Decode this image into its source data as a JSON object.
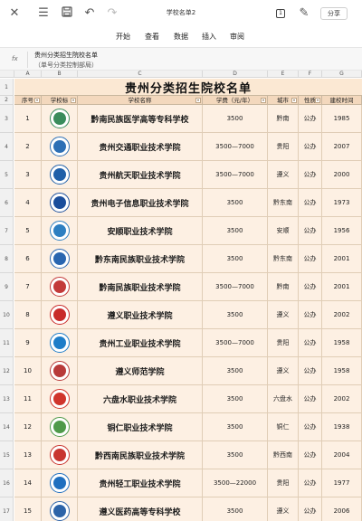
{
  "doc_title": "学校名单2",
  "toolbar": {
    "share_label": "分享",
    "badge_label": "1"
  },
  "menu": [
    "开始",
    "查看",
    "数据",
    "插入",
    "审阅"
  ],
  "formula": {
    "fx_label": "fx",
    "line1": "贵州分类招生院校名单",
    "line2": "（单号分类控制部局）"
  },
  "columns": [
    "A",
    "B",
    "C",
    "D",
    "E",
    "F",
    "G"
  ],
  "sheet": {
    "title": "贵州分类招生院校名单",
    "headers": [
      "序号",
      "学校标",
      "学校名称",
      "学费（元/年）",
      "城市",
      "性质",
      "建校时间"
    ]
  },
  "rows": [
    {
      "row": "3",
      "no": "1",
      "name": "黔南民族医学高等专科学校",
      "fee": "3500",
      "city": "黔南",
      "type": "公办",
      "year": "1985",
      "logo_color": "#3a8c5c"
    },
    {
      "row": "4",
      "no": "2",
      "name": "贵州交通职业技术学院",
      "fee": "3500—7000",
      "city": "贵阳",
      "type": "公办",
      "year": "2007",
      "logo_color": "#2d6fb5"
    },
    {
      "row": "5",
      "no": "3",
      "name": "贵州航天职业技术学院",
      "fee": "3500—7000",
      "city": "遵义",
      "type": "公办",
      "year": "2000",
      "logo_color": "#1f5fa8"
    },
    {
      "row": "6",
      "no": "4",
      "name": "贵州电子信息职业技术学院",
      "fee": "3500",
      "city": "黔东南",
      "type": "公办",
      "year": "1973",
      "logo_color": "#1b4e9b"
    },
    {
      "row": "7",
      "no": "5",
      "name": "安顺职业技术学院",
      "fee": "3500",
      "city": "安顺",
      "type": "公办",
      "year": "1956",
      "logo_color": "#2d7fc1"
    },
    {
      "row": "8",
      "no": "6",
      "name": "黔东南民族职业技术学院",
      "fee": "3500",
      "city": "黔东南",
      "type": "公办",
      "year": "2001",
      "logo_color": "#2a66b0"
    },
    {
      "row": "9",
      "no": "7",
      "name": "黔南民族职业技术学院",
      "fee": "3500—7000",
      "city": "黔南",
      "type": "公办",
      "year": "2001",
      "logo_color": "#c33a3a"
    },
    {
      "row": "10",
      "no": "8",
      "name": "遵义职业技术学院",
      "fee": "3500",
      "city": "遵义",
      "type": "公办",
      "year": "2002",
      "logo_color": "#c82a2a"
    },
    {
      "row": "11",
      "no": "9",
      "name": "贵州工业职业技术学院",
      "fee": "3500—7000",
      "city": "贵阳",
      "type": "公办",
      "year": "1958",
      "logo_color": "#1e7dc8"
    },
    {
      "row": "12",
      "no": "10",
      "name": "遵义师范学院",
      "fee": "3500",
      "city": "遵义",
      "type": "公办",
      "year": "1958",
      "logo_color": "#b83a3a"
    },
    {
      "row": "13",
      "no": "11",
      "name": "六盘水职业技术学院",
      "fee": "3500",
      "city": "六盘水",
      "type": "公办",
      "year": "2002",
      "logo_color": "#d0342c"
    },
    {
      "row": "14",
      "no": "12",
      "name": "铜仁职业技术学院",
      "fee": "3500",
      "city": "铜仁",
      "type": "公办",
      "year": "1938",
      "logo_color": "#4f9a4a"
    },
    {
      "row": "15",
      "no": "13",
      "name": "黔西南民族职业技术学院",
      "fee": "3500",
      "city": "黔西南",
      "type": "公办",
      "year": "2004",
      "logo_color": "#c8342f"
    },
    {
      "row": "16",
      "no": "14",
      "name": "贵州轻工职业技术学院",
      "fee": "3500—22000",
      "city": "贵阳",
      "type": "公办",
      "year": "1977",
      "logo_color": "#1f6fbf"
    },
    {
      "row": "17",
      "no": "15",
      "name": "遵义医药高等专科学校",
      "fee": "3500",
      "city": "遵义",
      "type": "公办",
      "year": "2006",
      "logo_color": "#2c63a8"
    }
  ]
}
